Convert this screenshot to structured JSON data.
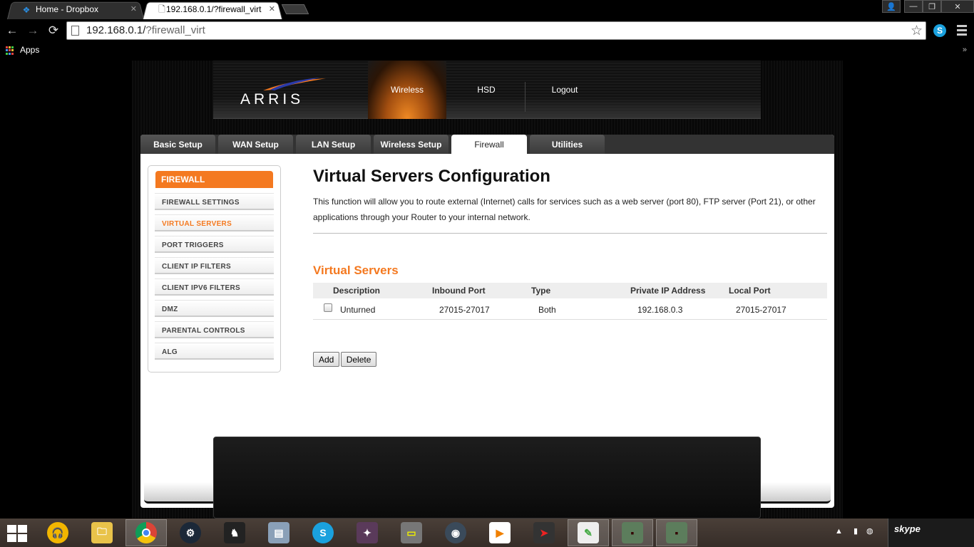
{
  "browser": {
    "tabs": [
      {
        "title": "Home - Dropbox",
        "icon": "dropbox-icon",
        "active": false
      },
      {
        "title": "192.168.0.1/?firewall_virt",
        "icon": "page-icon",
        "active": true
      }
    ],
    "url_host": "192.168.0.1/",
    "url_path": "?firewall_virt",
    "bookmarks": {
      "apps_label": "Apps",
      "more": "»"
    },
    "window_controls": {
      "user": "👤",
      "minimize": "—",
      "restore": "❐",
      "close": "✕"
    }
  },
  "router": {
    "brand": "ARRIS",
    "top_nav": [
      "Wireless",
      "HSD",
      "Logout"
    ],
    "active_top_nav": "Wireless",
    "tabs": [
      "Basic Setup",
      "WAN Setup",
      "LAN Setup",
      "Wireless Setup",
      "Firewall",
      "Utilities"
    ],
    "active_tab": "Firewall",
    "sidebar": {
      "heading": "FIREWALL",
      "items": [
        "FIREWALL SETTINGS",
        "VIRTUAL SERVERS",
        "PORT TRIGGERS",
        "CLIENT IP FILTERS",
        "CLIENT IPV6 FILTERS",
        "DMZ",
        "PARENTAL CONTROLS",
        "ALG"
      ],
      "active_item": "VIRTUAL SERVERS"
    },
    "page_title": "Virtual Servers Configuration",
    "page_description": "This function will allow you to route external (Internet) calls for services such as a web server (port 80), FTP server (Port 21), or other applications through your Router to your internal network.",
    "section_title": "Virtual Servers",
    "table": {
      "columns": [
        "Description",
        "Inbound Port",
        "Type",
        "Private IP Address",
        "Local Port"
      ],
      "rows": [
        {
          "description": "Unturned",
          "inbound_port": "27015-27017",
          "type": "Both",
          "private_ip": "192.168.0.3",
          "local_port": "27015-27017",
          "checked": false
        }
      ]
    },
    "buttons": {
      "add": "Add",
      "delete": "Delete"
    }
  },
  "taskbar": {
    "apps": [
      "audacity-icon",
      "file-explorer-icon",
      "chrome-icon",
      "steam-icon",
      "game-character-icon",
      "system-monitor-icon",
      "skype-icon",
      "game-icon",
      "monitor-99-icon",
      "teamspeak-icon",
      "media-player-icon",
      "racing-game-icon",
      "notepad-plus-icon",
      "zombie-game-icon",
      "zombie-game-icon-2"
    ],
    "active_app": "chrome-icon",
    "skype_label": "skype"
  },
  "colors": {
    "accent_orange": "#f47920",
    "dark_bg": "#000000",
    "panel_bg": "#ffffff"
  }
}
